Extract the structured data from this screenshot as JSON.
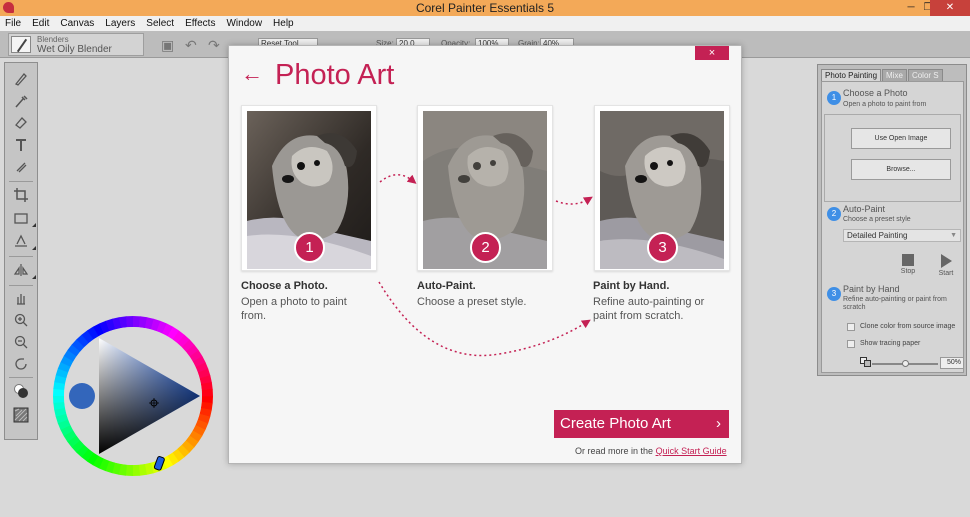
{
  "window": {
    "title": "Corel Painter Essentials 5",
    "minimize": "─",
    "restore": "❐",
    "close": "✕"
  },
  "menu": [
    "File",
    "Edit",
    "Canvas",
    "Layers",
    "Select",
    "Effects",
    "Window",
    "Help"
  ],
  "property_bar": {
    "brush_category": "Blenders",
    "brush_variant": "Wet Oily Blender",
    "reset_tool": "Reset Tool",
    "size_label": "Size:",
    "size_value": "20.0",
    "opacity_label": "Opacity:",
    "opacity_value": "100%",
    "grain_label": "Grain:",
    "grain_value": "40%"
  },
  "dialog": {
    "close": "×",
    "back": "←",
    "title": "Photo Art",
    "steps": [
      {
        "number": "1",
        "title": "Choose a Photo.",
        "description": "Open a photo to paint from."
      },
      {
        "number": "2",
        "title": "Auto-Paint.",
        "description": "Choose a preset style."
      },
      {
        "number": "3",
        "title": "Paint by Hand.",
        "description": "Refine auto-painting or paint from scratch."
      }
    ],
    "create_button": "Create Photo Art",
    "create_chevron": "›",
    "read_more_prefix": "Or read more in the",
    "read_more_link": "Quick Start Guide"
  },
  "panel": {
    "tabs": [
      "Photo Painting",
      "Mixe",
      "Color S"
    ],
    "sections": [
      {
        "number": "1",
        "title": "Choose a Photo",
        "subtitle": "Open a photo to paint from"
      },
      {
        "number": "2",
        "title": "Auto-Paint",
        "subtitle": "Choose a preset style"
      },
      {
        "number": "3",
        "title": "Paint by Hand",
        "subtitle": "Refine auto-painting or paint from scratch"
      }
    ],
    "use_open_image": "Use Open Image",
    "browse": "Browse...",
    "preset_value": "Detailed Painting",
    "stop_label": "Stop",
    "start_label": "Start",
    "clone_color": "Clone color from source image",
    "show_tracing": "Show tracing paper",
    "tracing_opacity": "50%",
    "tracing_opacity_fraction": 0.5
  },
  "colors": {
    "accent": "#c42154",
    "title_bar": "#f3a958",
    "panel_step": "#3f8fe6",
    "main_color": "#3366bb",
    "dialog_bg": "#f6f6f6"
  }
}
